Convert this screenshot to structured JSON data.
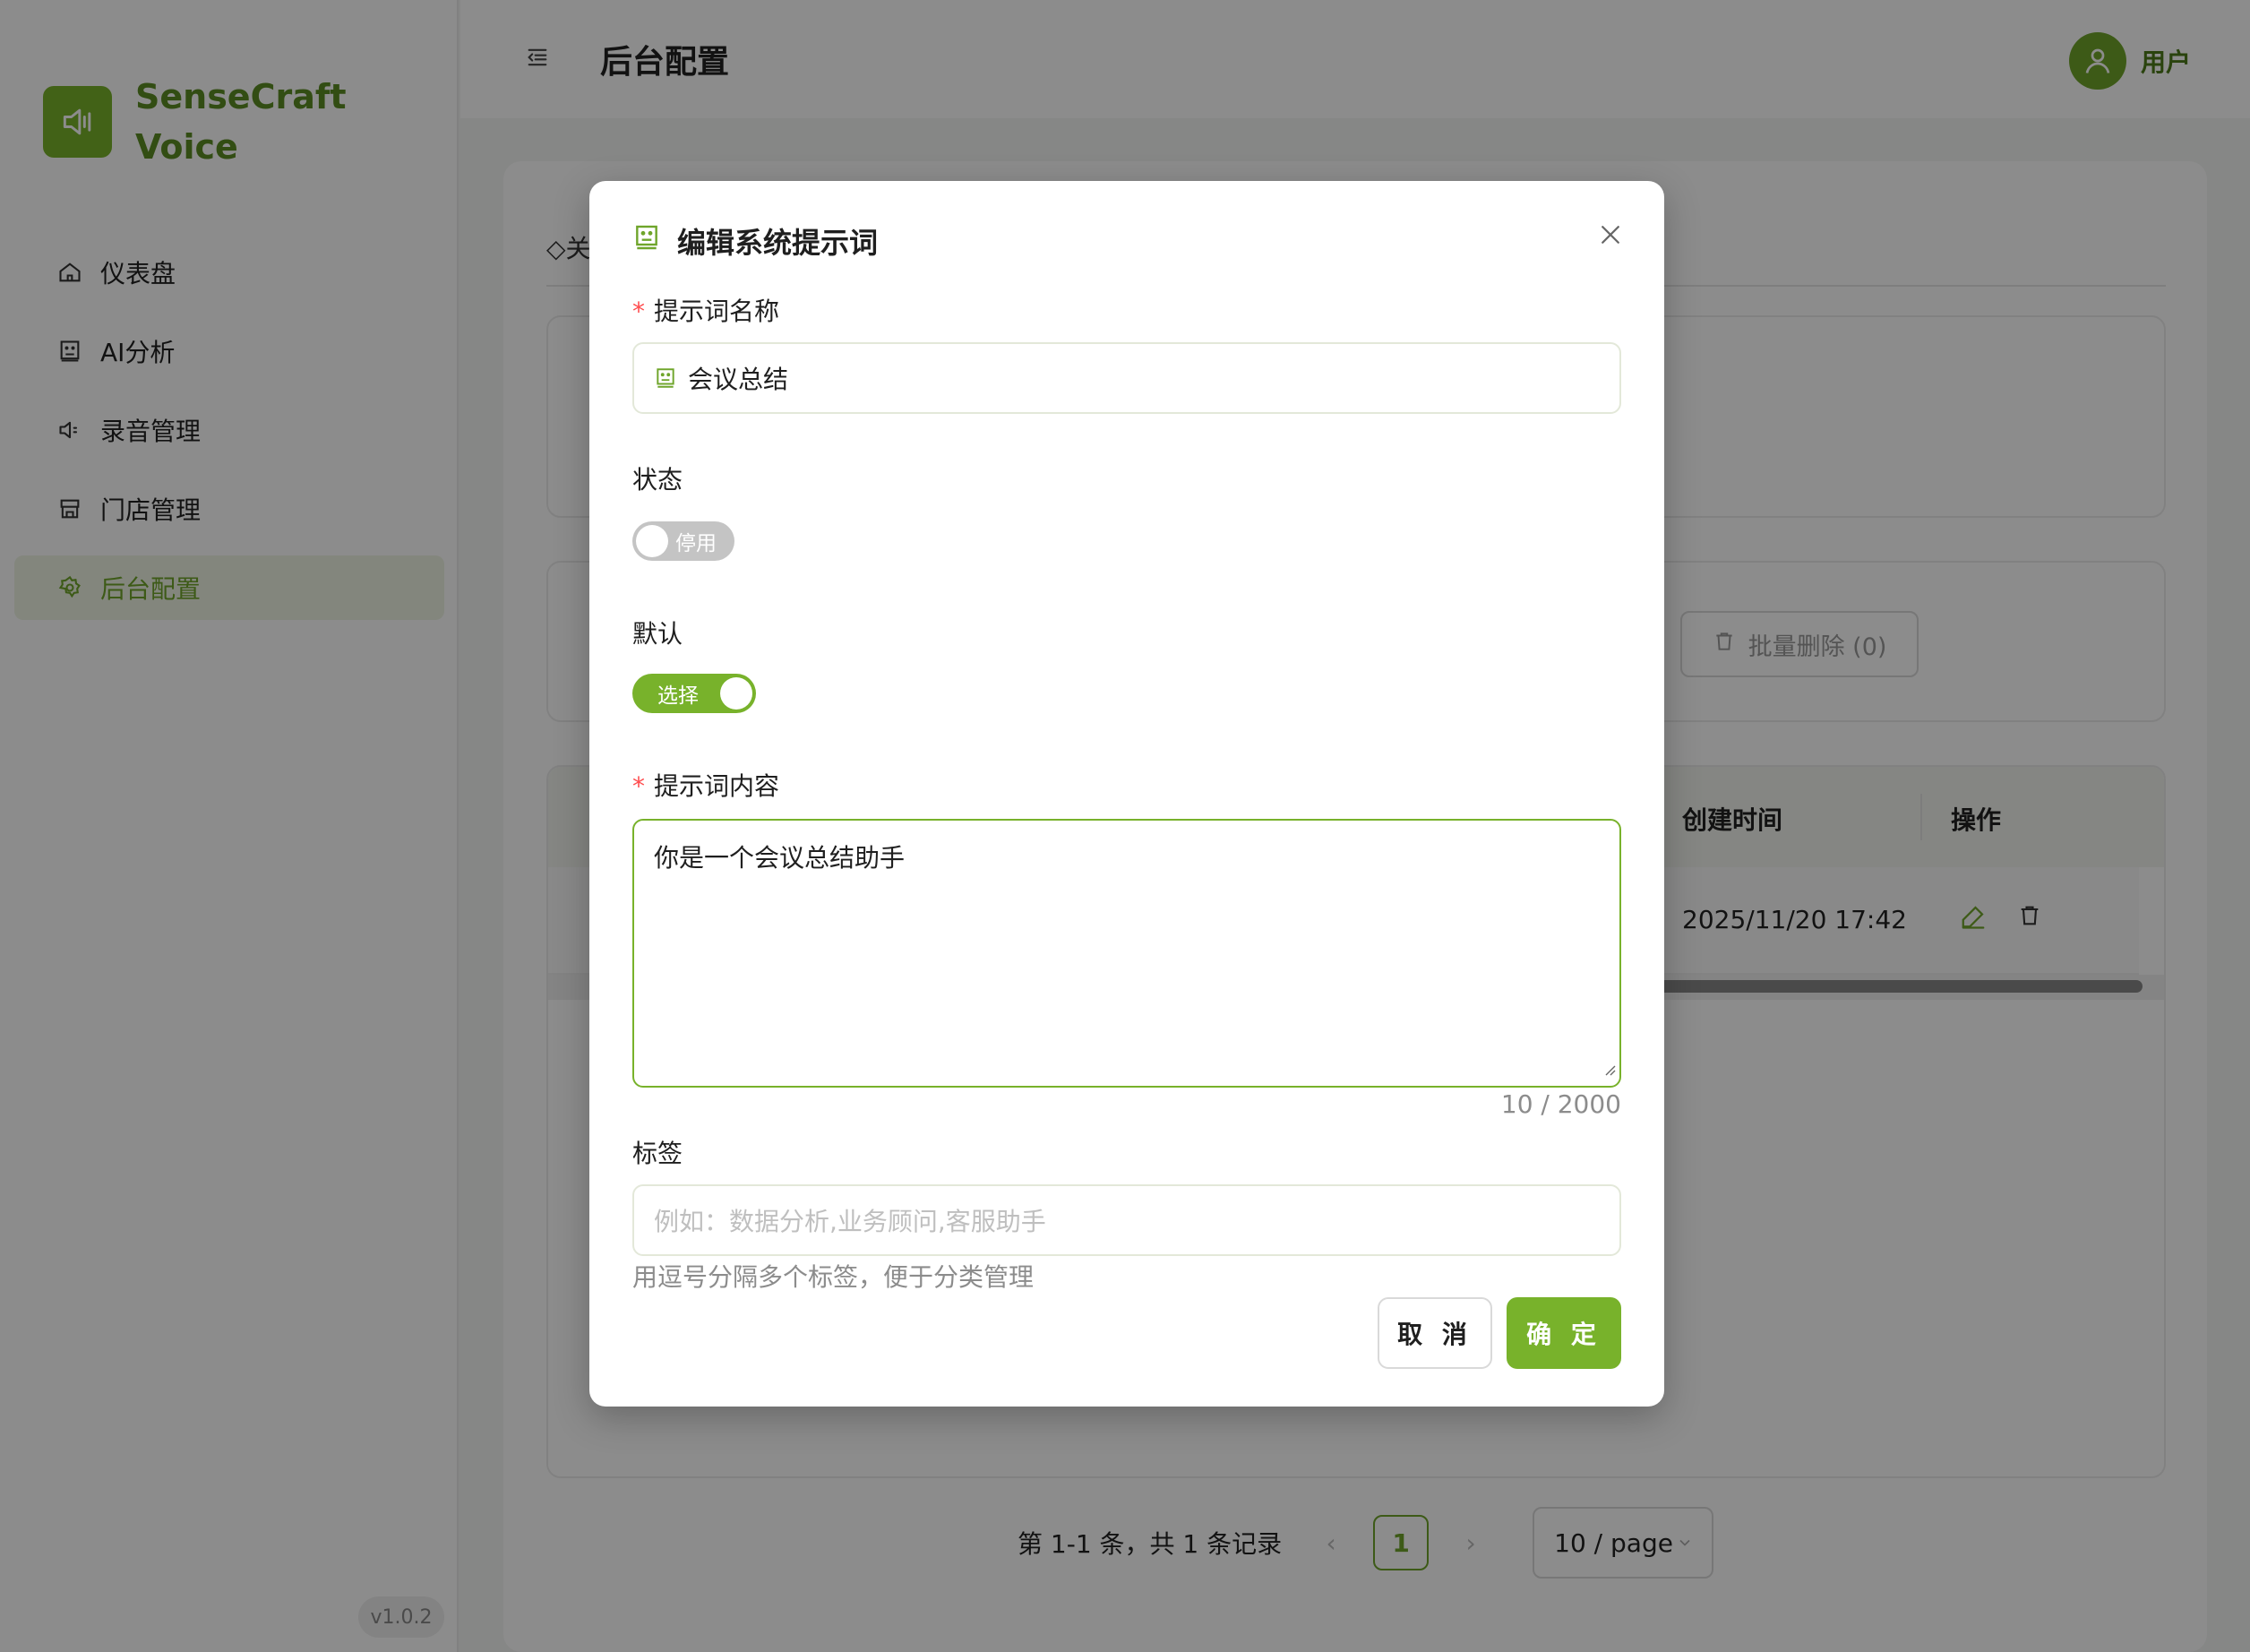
{
  "sidebar": {
    "brand_line1": "SenseCraft",
    "brand_line2": "Voice",
    "items": [
      {
        "label": "仪表盘",
        "icon": "home-icon"
      },
      {
        "label": "AI分析",
        "icon": "robot-icon"
      },
      {
        "label": "录音管理",
        "icon": "speaker-icon"
      },
      {
        "label": "门店管理",
        "icon": "store-icon"
      },
      {
        "label": "后台配置",
        "icon": "gear-icon",
        "active": true
      }
    ],
    "version": "v1.0.2"
  },
  "header": {
    "title": "后台配置",
    "user_name": "用户"
  },
  "background": {
    "tab_fragment": "关",
    "bulk_delete": "批量删除 (0)",
    "table": {
      "columns": [
        "创建时间",
        "操作"
      ],
      "rows": [
        {
          "created": "2025/11/20 17:42"
        }
      ]
    },
    "pagination": {
      "total_text": "第 1-1 条，共 1 条记录",
      "current_page": "1",
      "page_size": "10 / page"
    }
  },
  "modal": {
    "title": "编辑系统提示词",
    "name_label": "提示词名称",
    "name_value": "会议总结",
    "status_label": "状态",
    "status_switch_text": "停用",
    "status_on": false,
    "default_label": "默认",
    "default_switch_text": "选择",
    "default_on": true,
    "content_label": "提示词内容",
    "content_value": "你是一个会议总结助手",
    "content_counter": "10 / 2000",
    "tags_label": "标签",
    "tags_placeholder": "例如：数据分析,业务顾问,客服助手",
    "tags_help": "用逗号分隔多个标签，便于分类管理",
    "cancel_label": "取 消",
    "ok_label": "确 定"
  },
  "colors": {
    "accent": "#78b22b",
    "accent_dark": "#5c8c23",
    "required": "#ff4d4f"
  }
}
